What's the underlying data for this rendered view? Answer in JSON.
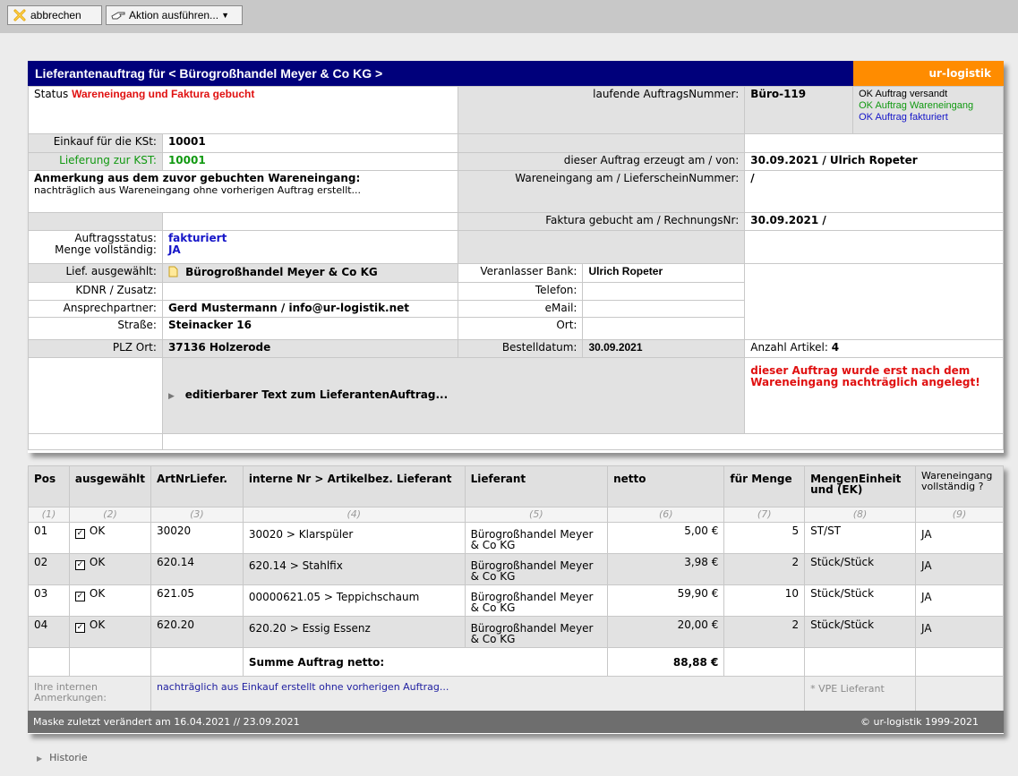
{
  "toolbar": {
    "cancel_label": "abbrechen",
    "action_label": "Aktion ausführen..."
  },
  "header": {
    "title": "Lieferantenauftrag für  < Bürogroßhandel Meyer & Co KG >",
    "brand": "ur-logistik"
  },
  "status": {
    "label": "Status",
    "value": "Wareneingang und Faktura gebucht",
    "order_no_label": "laufende AuftragsNummer:",
    "order_no": "Büro-119",
    "flags": [
      "OK Auftrag versandt",
      "OK Auftrag Wareneingang",
      "OK Auftrag fakturiert"
    ]
  },
  "info": {
    "einkauf_label": "Einkauf für die KSt:",
    "einkauf_value": "10001",
    "lieferung_label": "Lieferung zur  KST:",
    "lieferung_value": "10001",
    "created_label": "dieser Auftrag erzeugt am / von:",
    "created_value": "30.09.2021 / Ulrich Ropeter",
    "remark_title": "Anmerkung aus dem zuvor gebuchten Wareneingang:",
    "remark_text": "nachträglich aus Wareneingang ohne vorherigen Auftrag erstellt...",
    "wareneingang_label": "Wareneingang am / LieferscheinNummer:",
    "wareneingang_value": "/",
    "faktura_label": "Faktura gebucht am / RechnungsNr:",
    "faktura_value": "30.09.2021 /",
    "auftragsstatus_label": "Auftragsstatus:",
    "menge_label": "Menge vollständig:",
    "auftragsstatus_value": "fakturiert",
    "menge_value": "JA"
  },
  "supplier": {
    "lief_label": "Lief. ausgewählt:",
    "lief_value": "Bürogroßhandel Meyer & Co KG",
    "kdnr_label": "KDNR / Zusatz:",
    "kdnr_value": "",
    "ansprech_label": "Ansprechpartner:",
    "ansprech_value": "Gerd Mustermann / info@ur-logistik.net",
    "strasse_label": "Straße:",
    "strasse_value": "Steinacker 16",
    "plz_label": "PLZ Ort:",
    "plz_value": "37136 Holzerode",
    "bank_label": "Veranlasser Bank:",
    "bank_value": "Ulrich Ropeter",
    "telefon_label": "Telefon:",
    "email_label": "eMail:",
    "ort_label": "Ort:",
    "bestell_label": "Bestelldatum:",
    "bestell_value": "30.09.2021",
    "anzahl_label": "Anzahl Artikel:",
    "anzahl_value": "4",
    "edit_text": "editierbarer Text zum LieferantenAuftrag...",
    "warning": "dieser Auftrag wurde erst nach dem Wareneingang nachträglich angelegt!"
  },
  "items": {
    "headers": [
      "Pos",
      "ausgewählt",
      "ArtNrLiefer.",
      "interne Nr > Artikelbez. Lieferant",
      "Lieferant",
      "netto",
      "für Menge",
      "MengenEinheit und (EK)",
      "Wareneingang vollständig ?"
    ],
    "indices": [
      "(1)",
      "(2)",
      "(3)",
      "(4)",
      "(5)",
      "(6)",
      "(7)",
      "(8)",
      "(9)"
    ],
    "rows": [
      {
        "pos": "01",
        "sel": "OK",
        "art": "30020",
        "desc": "30020 > Klarspüler",
        "lief": "Bürogroßhandel Meyer & Co KG",
        "netto": "5,00 €",
        "menge": "5",
        "einheit": "ST/ST",
        "we": "JA"
      },
      {
        "pos": "02",
        "sel": "OK",
        "art": "620.14",
        "desc": "620.14 > Stahlfix",
        "lief": "Bürogroßhandel Meyer & Co KG",
        "netto": "3,98 €",
        "menge": "2",
        "einheit": "Stück/Stück",
        "we": "JA"
      },
      {
        "pos": "03",
        "sel": "OK",
        "art": "621.05",
        "desc": "00000621.05 > Teppichschaum",
        "lief": "Bürogroßhandel Meyer & Co KG",
        "netto": "59,90 €",
        "menge": "10",
        "einheit": "Stück/Stück",
        "we": "JA"
      },
      {
        "pos": "04",
        "sel": "OK",
        "art": "620.20",
        "desc": "620.20 > Essig Essenz",
        "lief": "Bürogroßhandel Meyer & Co KG",
        "netto": "20,00 €",
        "menge": "2",
        "einheit": "Stück/Stück",
        "we": "JA"
      }
    ],
    "sum_label": "Summe Auftrag netto:",
    "sum_value": "88,88 €",
    "notes_label": "Ihre internen Anmerkungen:",
    "notes_value": "nachträglich aus Einkauf erstellt ohne vorherigen Auftrag...",
    "vpe_label": "* VPE Lieferant"
  },
  "footer": {
    "changed": "Maske zuletzt verändert am 16.04.2021  // 23.09.2021",
    "copyright": "© ur-logistik 1999-2021"
  },
  "historie": "Historie"
}
